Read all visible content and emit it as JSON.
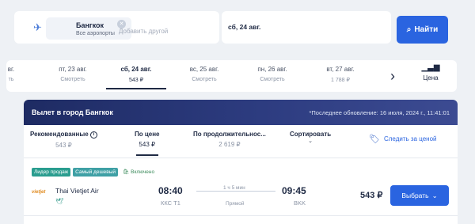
{
  "search": {
    "dest_city": "Бангкок",
    "dest_sub": "Все аэропорты",
    "add_other": "Добавить другой",
    "date": "сб, 24 авг.",
    "find_label": "Найти"
  },
  "dates": [
    {
      "day": "пт, 23 авг.",
      "price": "Смотреть"
    },
    {
      "day": "сб, 24 авг.",
      "price": "543 ₽"
    },
    {
      "day": "вс, 25 авг.",
      "price": "Смотреть"
    },
    {
      "day": "пн, 26 авг.",
      "price": "Смотреть"
    },
    {
      "day": "вт, 27 авг.",
      "price": "1 788 ₽"
    }
  ],
  "price_toggle_label": "Цена",
  "results": {
    "title": "Вылет в город Бангкок",
    "update": "*Последнее обновление: 16 июля, 2024 г., 11:41:01",
    "sort": [
      {
        "label": "Рекомендованные",
        "value": "543 ₽"
      },
      {
        "label": "По цене",
        "value": "543 ₽"
      },
      {
        "label": "По продолжительнос...",
        "value": "2 619 ₽"
      }
    ],
    "sort_dropdown": "Сортировать",
    "track_price": "Следить за ценой"
  },
  "flight": {
    "badges": [
      "Лидер продаж",
      "Самый дешевый",
      "Включено"
    ],
    "airline": "Thai Vietjet Air",
    "logo_text": "vietjet",
    "dep_time": "08:40",
    "dep_code": "ККС Т1",
    "duration": "1 ч 5 мин",
    "direct": "Прямой",
    "arr_time": "09:45",
    "arr_code": "BKK",
    "price": "543 ₽",
    "select_label": "Выбрать"
  }
}
